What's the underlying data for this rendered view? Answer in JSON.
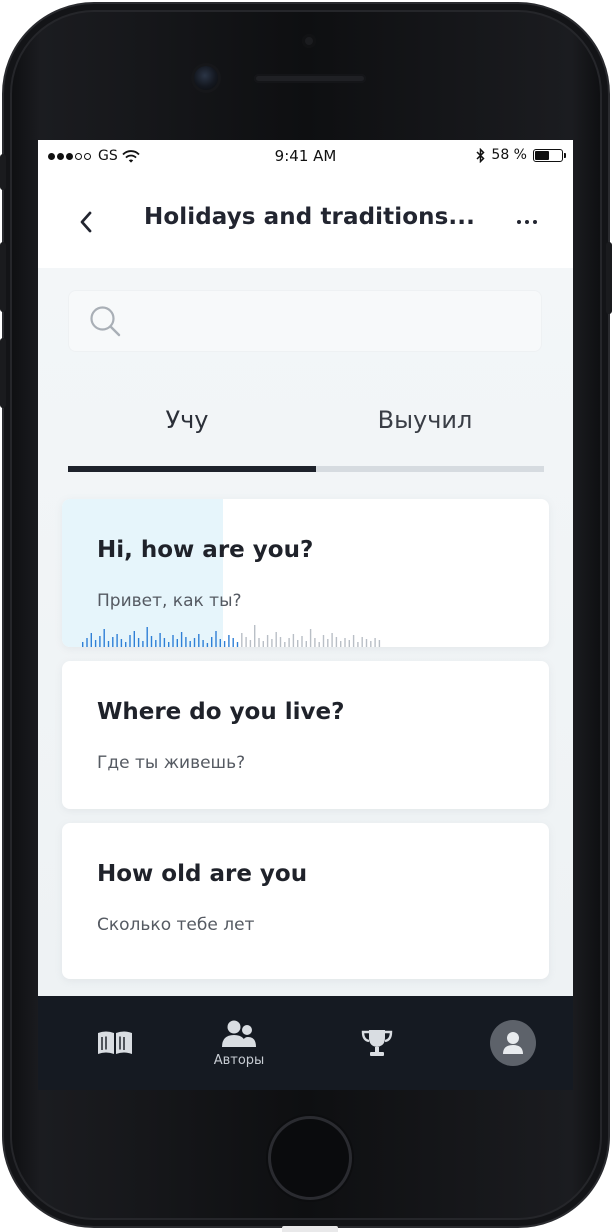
{
  "statusbar": {
    "carrier": "GS",
    "time": "9:41 AM",
    "battery": "58 %",
    "battery_level": 0.58
  },
  "navbar": {
    "title": "Holidays and traditions..."
  },
  "search": {
    "placeholder": ""
  },
  "tabs": [
    {
      "label": "Учу",
      "active": true
    },
    {
      "label": "Выучил",
      "active": false
    }
  ],
  "cards": [
    {
      "title": "Hi, how are you?",
      "subtitle": "Привет, как ты?",
      "progress": 0.33
    },
    {
      "title": "Where do you live?",
      "subtitle": "Где ты живешь?"
    },
    {
      "title": "How old are you",
      "subtitle": "Сколько тебе лет"
    }
  ],
  "tabbar": {
    "items": [
      {
        "icon": "book-icon",
        "label": ""
      },
      {
        "icon": "authors-icon",
        "label": "Авторы"
      },
      {
        "icon": "trophy-icon",
        "label": ""
      },
      {
        "icon": "profile-icon",
        "label": ""
      }
    ]
  },
  "colors": {
    "accent_dark": "#1e222b",
    "tabbar_bg": "#151a22",
    "progress_bg": "#e6f5fb",
    "waveform_active": "#2f7fd6",
    "waveform_inactive": "#b9bfc6"
  }
}
